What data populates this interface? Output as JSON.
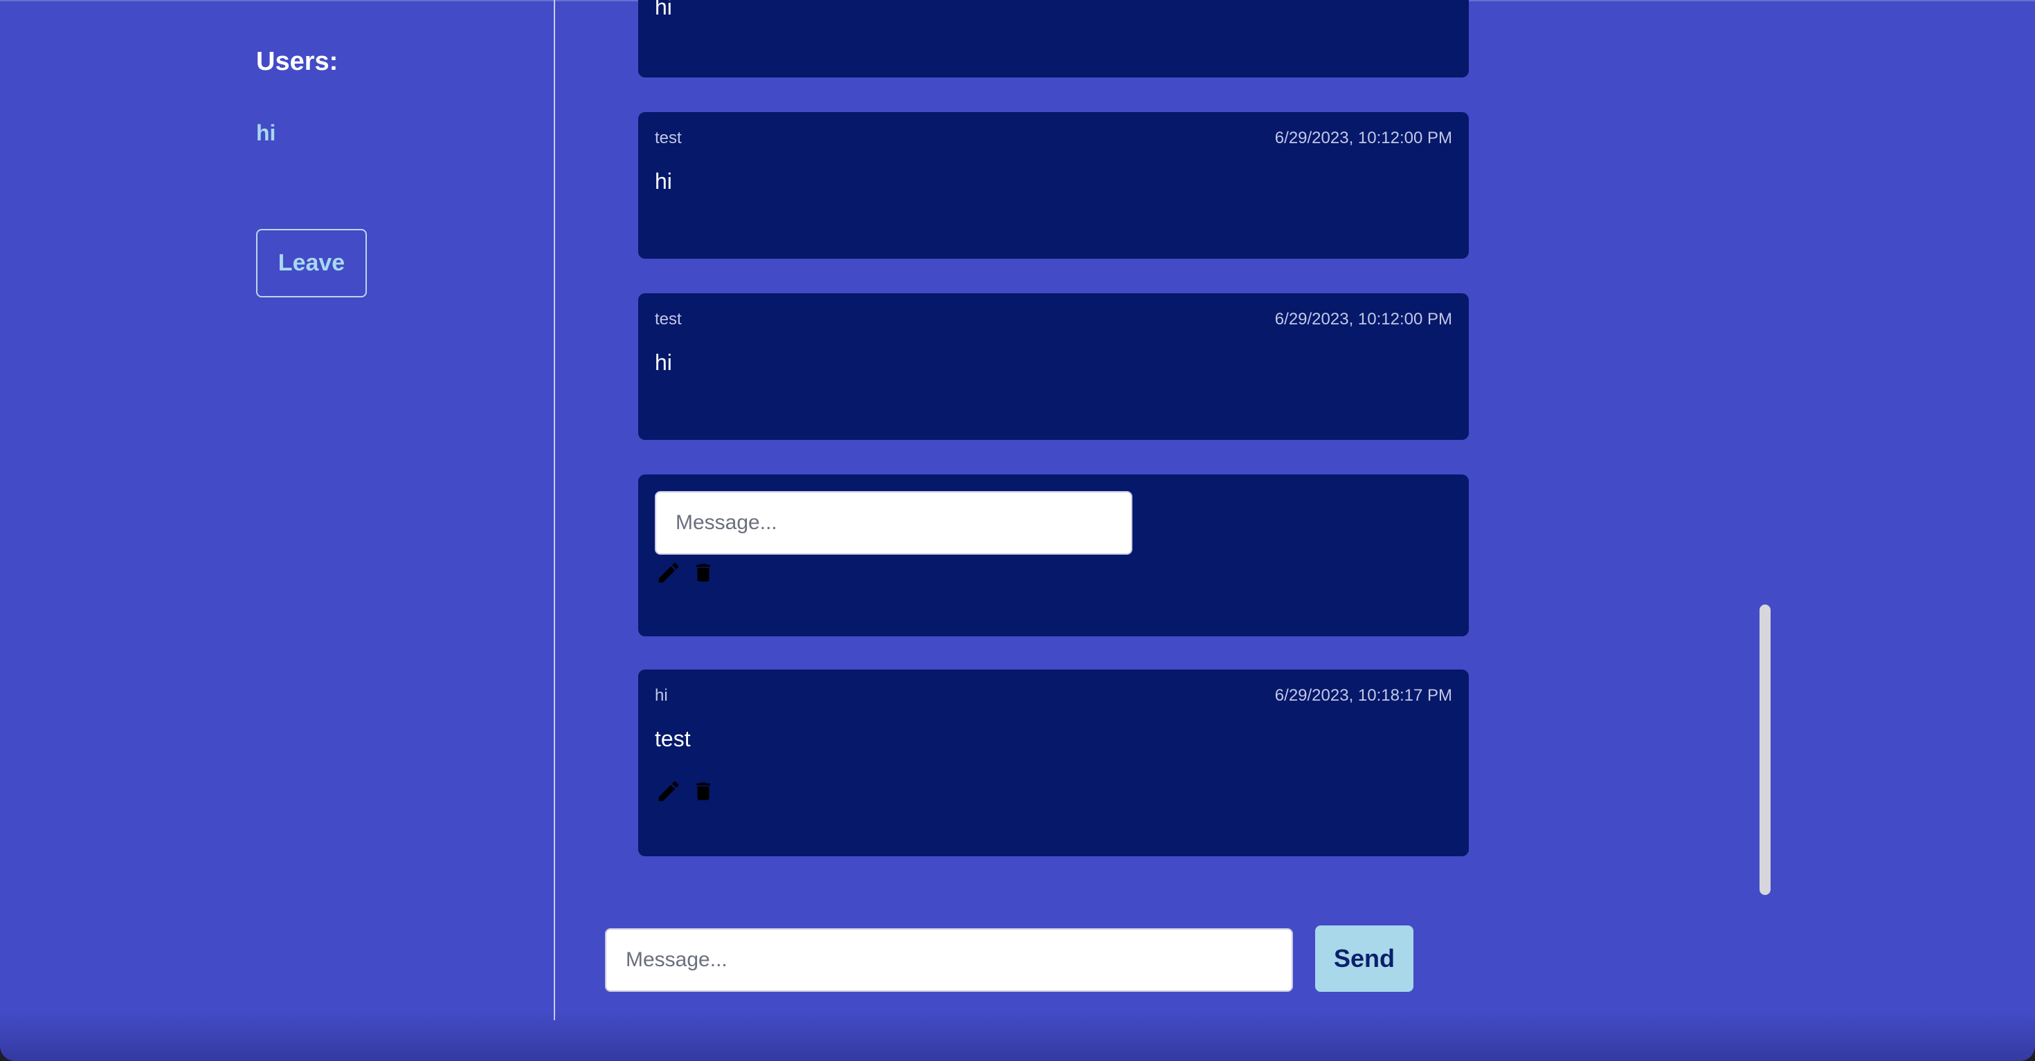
{
  "sidebar": {
    "heading": "Users:",
    "users": [
      "hi"
    ],
    "leave_label": "Leave"
  },
  "messages": [
    {
      "text": "hi"
    },
    {
      "user": "test",
      "time": "6/29/2023, 10:12:00 PM",
      "text": "hi"
    },
    {
      "user": "test",
      "time": "6/29/2023, 10:12:00 PM",
      "text": "hi"
    },
    {
      "edit_placeholder": "Message..."
    },
    {
      "user": "hi",
      "time": "6/29/2023, 10:18:17 PM",
      "text": "test"
    }
  ],
  "composer": {
    "placeholder": "Message...",
    "send_label": "Send"
  },
  "icons": {
    "edit": "pencil-icon",
    "delete": "trash-icon"
  }
}
